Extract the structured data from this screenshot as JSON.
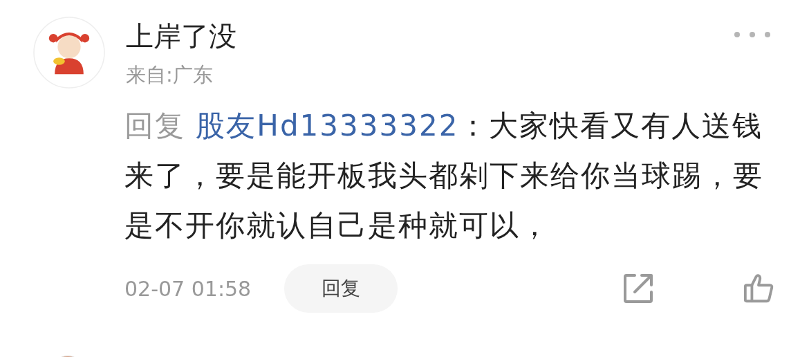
{
  "comment": {
    "user": "上岸了没",
    "location": "来自:广东",
    "reply_prefix": "回复",
    "reply_to": "股友Hd13333322",
    "separator": "：",
    "text": "大家快看又有人送钱来了，要是能开板我头都剁下来给你当球踢，要是不开你就认自己是种就可以，",
    "time": "02-07 01:58",
    "reply_button": "回复"
  }
}
